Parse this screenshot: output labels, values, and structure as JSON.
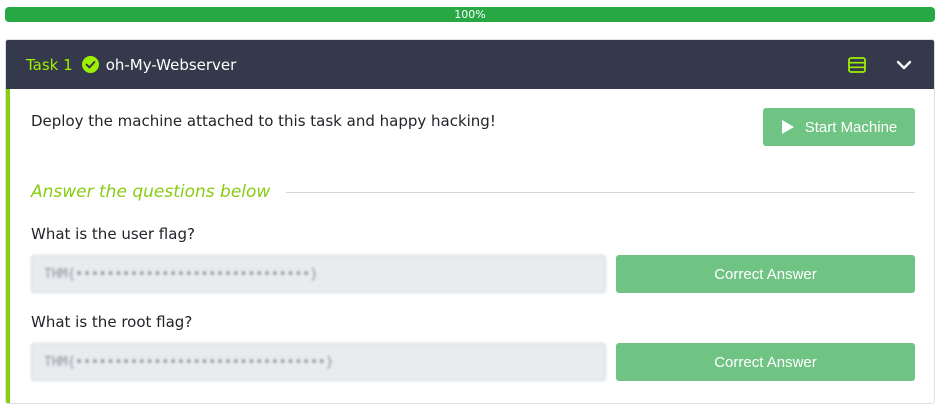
{
  "progress": {
    "label": "100%",
    "percent": 100
  },
  "task": {
    "number_label": "Task 1",
    "title": "oh-My-Webserver",
    "description": "Deploy the machine attached to this task and happy hacking!",
    "start_button_label": "Start Machine",
    "answers_heading": "Answer the questions below",
    "questions": [
      {
        "text": "What is the user flag?",
        "answer": "THM{••••••••••••••••••••••••••••••}",
        "button_label": "Correct Answer"
      },
      {
        "text": "What is the root flag?",
        "answer": "THM{••••••••••••••••••••••••••••••••}",
        "button_label": "Correct Answer"
      }
    ]
  },
  "colors": {
    "progress_green": "#28a745",
    "header_bg": "#343a4c",
    "accent_lime": "#88cc14",
    "button_green": "#6fc483"
  },
  "icons": {
    "check": "check-circle-icon",
    "list": "list-icon",
    "chevron": "chevron-down-icon",
    "play": "play-icon"
  }
}
